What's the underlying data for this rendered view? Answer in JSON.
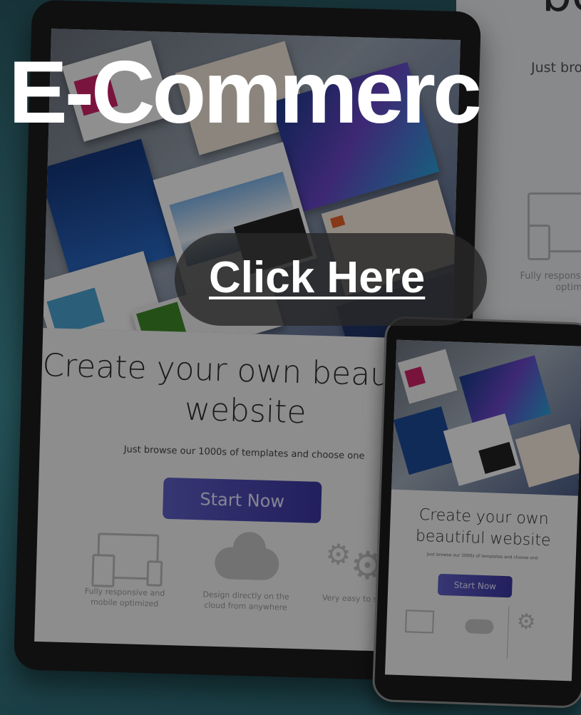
{
  "hero": {
    "title": "E-Commerc",
    "cta_label": "Click Here"
  },
  "back_page": {
    "heading_fragment": "be",
    "subtitle_fragment": "Just bro",
    "feature_text": "Fully responsi mobile optim"
  },
  "tablet_site": {
    "heading": "Create your own beautiful website",
    "subtitle": "Just browse our 1000s of templates and choose one",
    "button_label": "Start Now",
    "features": [
      {
        "icon": "devices-icon",
        "text": "Fully responsive and mobile optimized"
      },
      {
        "icon": "cloud-icon",
        "text": "Design directly on the cloud from anywhere"
      },
      {
        "icon": "gears-icon",
        "text": "Very easy to set up"
      }
    ]
  },
  "phone_site": {
    "heading": "Create your own beautiful website",
    "subtitle": "Just browse our 1000s of templates and choose one",
    "button_label": "Start Now"
  },
  "colors": {
    "overlay": "#000000",
    "cta_background": "#282828",
    "start_button": "#4a48b3",
    "backdrop": "#3f8f99"
  }
}
